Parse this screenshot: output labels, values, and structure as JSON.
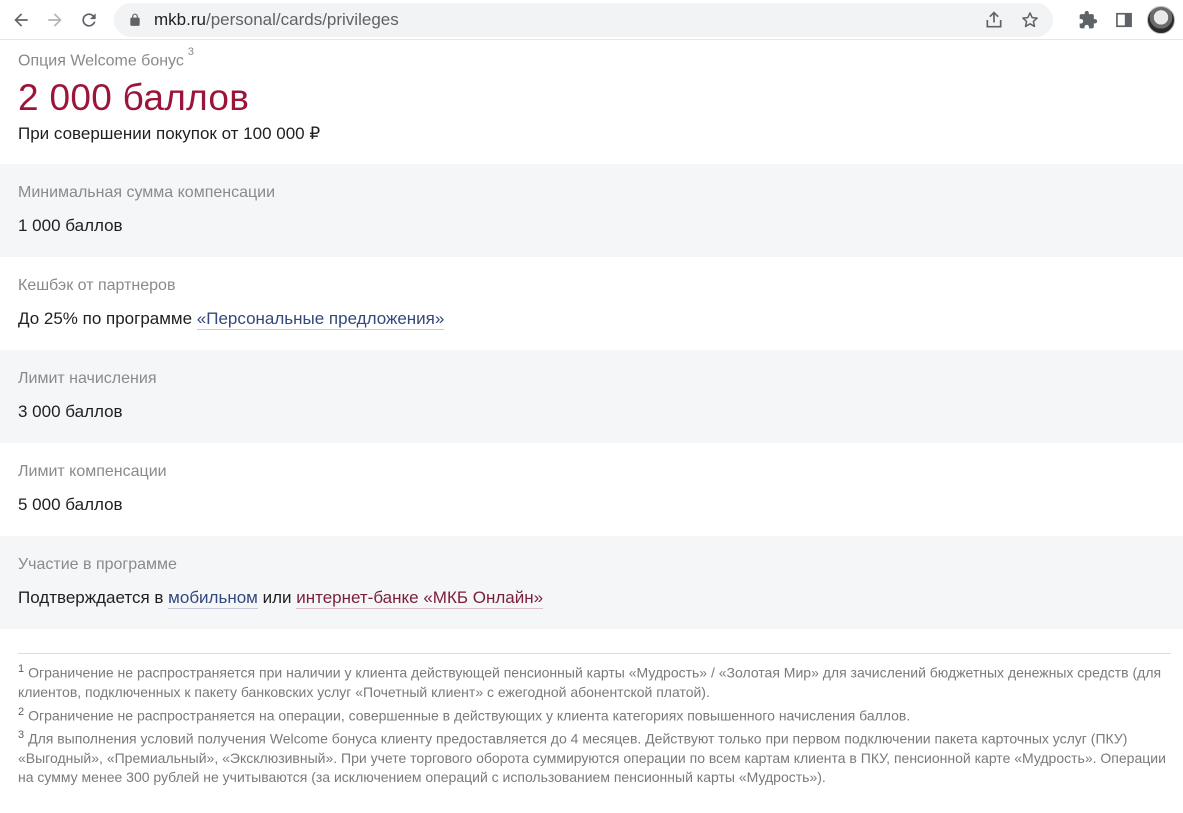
{
  "browser": {
    "url_host": "mkb.ru",
    "url_path": "/personal/cards/privileges"
  },
  "hero": {
    "label": "Опция Welcome бонус",
    "label_sup": "3",
    "amount": "2 000 баллов",
    "description": "При совершении покупок от 100 000 ₽"
  },
  "rows": [
    {
      "label": "Минимальная сумма компенсации",
      "value": "1 000 баллов"
    },
    {
      "label": "Кешбэк от партнеров",
      "value_prefix": "До 25% по программе ",
      "link": "«Персональные предложения»"
    },
    {
      "label": "Лимит начисления",
      "value": "3 000 баллов"
    },
    {
      "label": "Лимит компенсации",
      "value": "5 000 баллов"
    },
    {
      "label": "Участие в программе",
      "value_prefix": "Подтверждается в ",
      "link1": "мобильном",
      "connector": " или ",
      "link2": "интернет-банке «МКБ Онлайн»"
    }
  ],
  "footnotes": [
    {
      "num": "1",
      "text": "Ограничение не распространяется при наличии у клиента действующей пенсионный карты «Мудрость» / «Золотая Мир» для зачислений бюджетных денежных средств (для клиентов, подключенных к пакету банковских услуг «Почетный клиент» с ежегодной абонентской платой)."
    },
    {
      "num": "2",
      "text": "Ограничение не распространяется на операции, совершенные в действующих у клиента категориях повышенного начисления баллов."
    },
    {
      "num": "3",
      "text": "Для выполнения условий получения Welcome бонуса клиенту предоставляется до 4 месяцев. Действуют только при первом подключении пакета карточных услуг (ПКУ) «Выгодный», «Премиальный», «Эксклюзивный». При учете торгового оборота суммируются операции по всем картам клиента в ПКУ, пенсионной карте «Мудрость». Операции на сумму менее 300 рублей не учитываются (за исключением операций с использованием пенсионный карты «Мудрость»)."
    }
  ],
  "colors": {
    "accent": "#9b1538",
    "link": "#33487b",
    "link_alt": "#7a1f3a",
    "row_shade": "#f5f6f8"
  }
}
